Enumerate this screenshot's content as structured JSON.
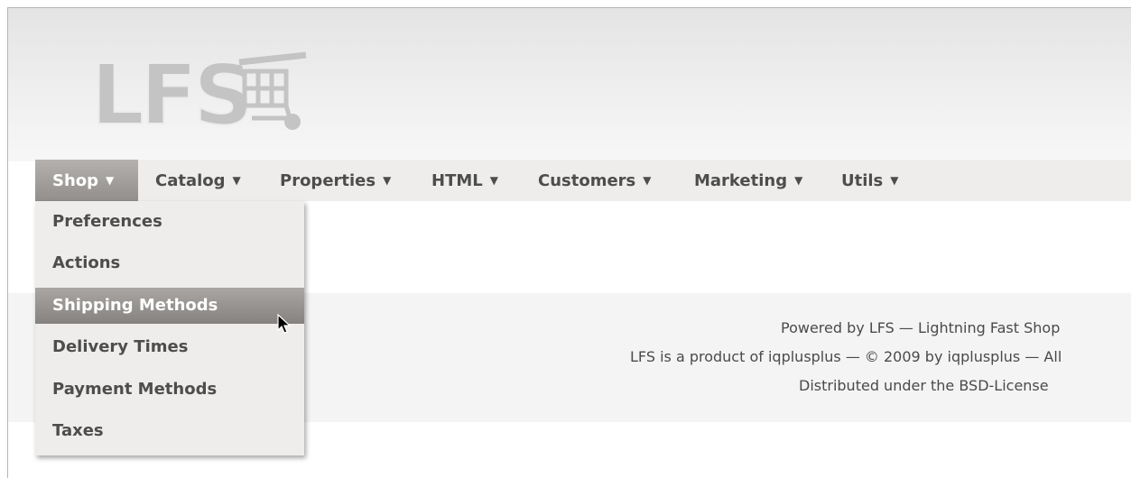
{
  "logo": {
    "text": "LFS",
    "icon": "shopping-cart-icon"
  },
  "nav": {
    "items": [
      {
        "label": "Shop",
        "icon": "triangle-down-icon",
        "active": true
      },
      {
        "label": "Catalog",
        "icon": "triangle-down-icon"
      },
      {
        "label": "Properties",
        "icon": "triangle-down-icon"
      },
      {
        "label": "HTML",
        "icon": "triangle-down-icon"
      },
      {
        "label": "Customers",
        "icon": "triangle-down-icon"
      },
      {
        "label": "Marketing",
        "icon": "triangle-down-icon"
      },
      {
        "label": "Utils",
        "icon": "triangle-down-icon"
      }
    ],
    "arrow_glyph": "▼"
  },
  "dropdown": {
    "items": [
      {
        "label": "Preferences"
      },
      {
        "label": "Actions"
      },
      {
        "label": "Shipping Methods",
        "hovered": true
      },
      {
        "label": "Delivery Times"
      },
      {
        "label": "Payment Methods"
      },
      {
        "label": "Taxes"
      }
    ]
  },
  "footer": {
    "line1": "Powered by LFS — Lightning Fast Shop",
    "line2": "LFS is a product of iqplusplus — © 2009 by iqplusplus — All",
    "line3": "Distributed under the BSD-License"
  },
  "colors": {
    "menu_bg": "#efedeb",
    "menu_text": "#4d4d4d",
    "active_bg": "#a3a09d",
    "logo_gray": "#c8c8c8"
  }
}
